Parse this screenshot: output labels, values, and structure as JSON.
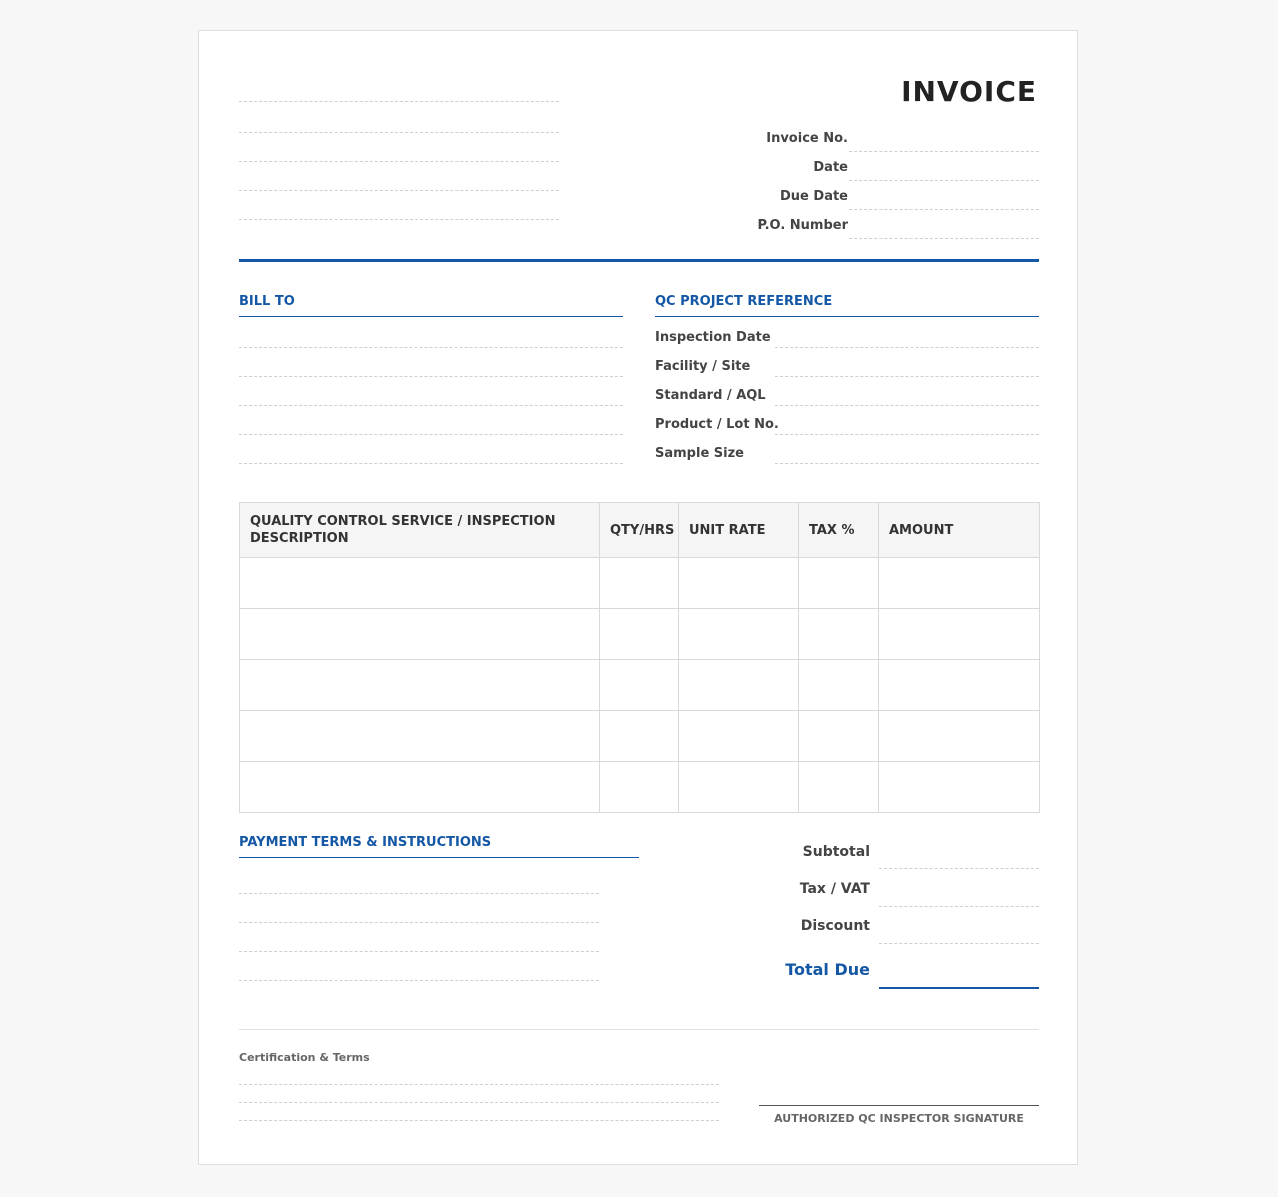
{
  "invoice": {
    "title": "INVOICE",
    "fields": [
      "Invoice No.",
      "Date",
      "Due Date",
      "P.O. Number"
    ]
  },
  "bill_to": {
    "heading": "BILL TO"
  },
  "project_ref": {
    "heading": "QC PROJECT REFERENCE",
    "fields": [
      "Inspection Date",
      "Facility / Site",
      "Standard / AQL",
      "Product / Lot No.",
      "Sample Size"
    ]
  },
  "items_table": {
    "headers": [
      "QUALITY CONTROL SERVICE / INSPECTION DESCRIPTION",
      "QTY/HRS",
      "UNIT RATE",
      "TAX %",
      "AMOUNT"
    ]
  },
  "payment": {
    "heading": "PAYMENT TERMS & INSTRUCTIONS"
  },
  "totals": {
    "subtotal": "Subtotal",
    "tax": "Tax / VAT",
    "discount": "Discount",
    "total_due": "Total Due"
  },
  "footer": {
    "certification": "Certification & Terms",
    "signature": "AUTHORIZED QC INSPECTOR SIGNATURE"
  }
}
